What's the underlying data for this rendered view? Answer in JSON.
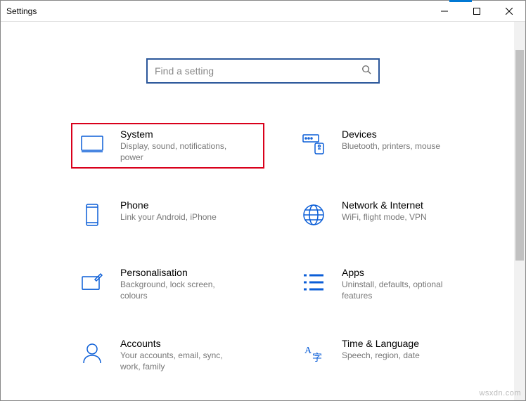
{
  "window": {
    "title": "Settings"
  },
  "search": {
    "placeholder": "Find a setting",
    "value": ""
  },
  "cards": {
    "system": {
      "title": "System",
      "desc": "Display, sound, notifications, power"
    },
    "devices": {
      "title": "Devices",
      "desc": "Bluetooth, printers, mouse"
    },
    "phone": {
      "title": "Phone",
      "desc": "Link your Android, iPhone"
    },
    "network": {
      "title": "Network & Internet",
      "desc": "WiFi, flight mode, VPN"
    },
    "personalisation": {
      "title": "Personalisation",
      "desc": "Background, lock screen, colours"
    },
    "apps": {
      "title": "Apps",
      "desc": "Uninstall, defaults, optional features"
    },
    "accounts": {
      "title": "Accounts",
      "desc": "Your accounts, email, sync, work, family"
    },
    "time": {
      "title": "Time & Language",
      "desc": "Speech, region, date"
    }
  },
  "watermark": "wsxdn.com"
}
